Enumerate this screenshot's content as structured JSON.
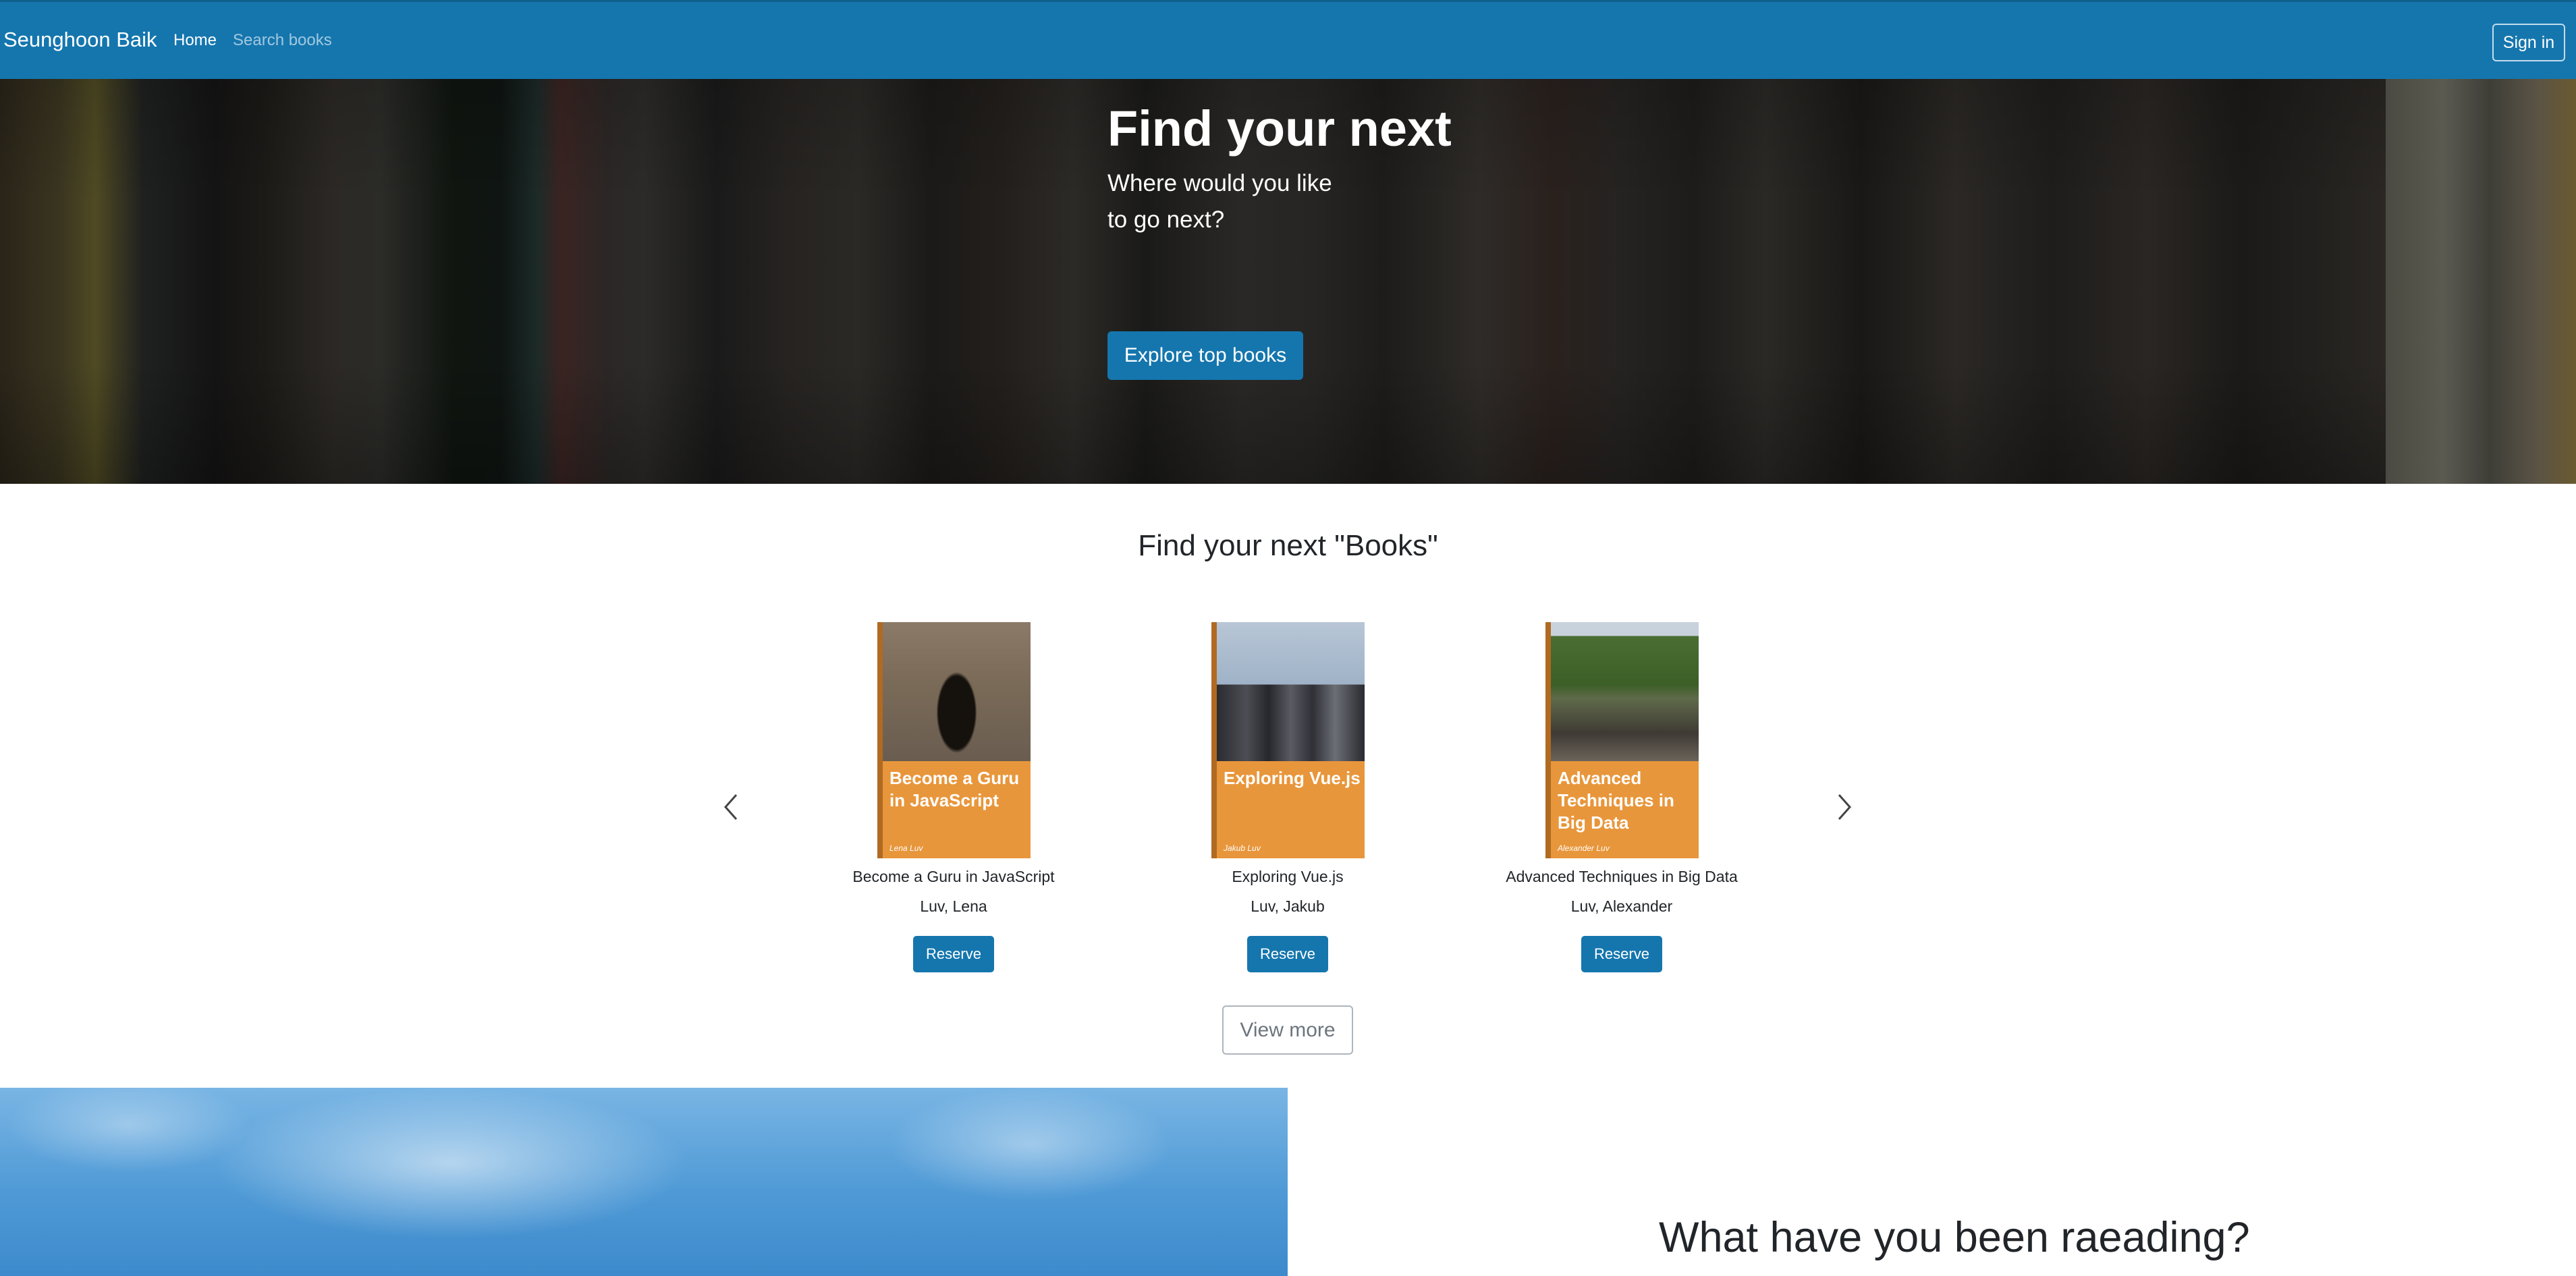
{
  "navbar": {
    "brand": "Seunghoon Baik",
    "links": [
      {
        "label": "Home"
      },
      {
        "label": "Search books"
      }
    ],
    "signin_label": "Sign in",
    "background_color": "#1576ae"
  },
  "hero": {
    "title": "Find your next",
    "subtitle_lines": [
      "Where would you like",
      "to go next?"
    ],
    "button_label": "Explore top books"
  },
  "books_section": {
    "title": "Find your next \"Books\"",
    "prev_icon": "chevron-left-icon",
    "next_icon": "chevron-right-icon",
    "books": [
      {
        "title": "Become a Guru in JavaScript",
        "author": "Luv, Lena",
        "cover_title": "Become a Guru in JavaScript",
        "cover_author": "Lena Luv",
        "reserve_label": "Reserve"
      },
      {
        "title": "Exploring Vue.js",
        "author": "Luv, Jakub",
        "cover_title": "Exploring Vue.js",
        "cover_author": "Jakub Luv",
        "reserve_label": "Reserve"
      },
      {
        "title": "Advanced Techniques in Big Data",
        "author": "Luv, Alexander",
        "cover_title": "Advanced Techniques in Big Data",
        "cover_author": "Alexander Luv",
        "reserve_label": "Reserve"
      }
    ],
    "view_more_label": "View more"
  },
  "reading_section": {
    "title": "What have you been raeading?"
  }
}
